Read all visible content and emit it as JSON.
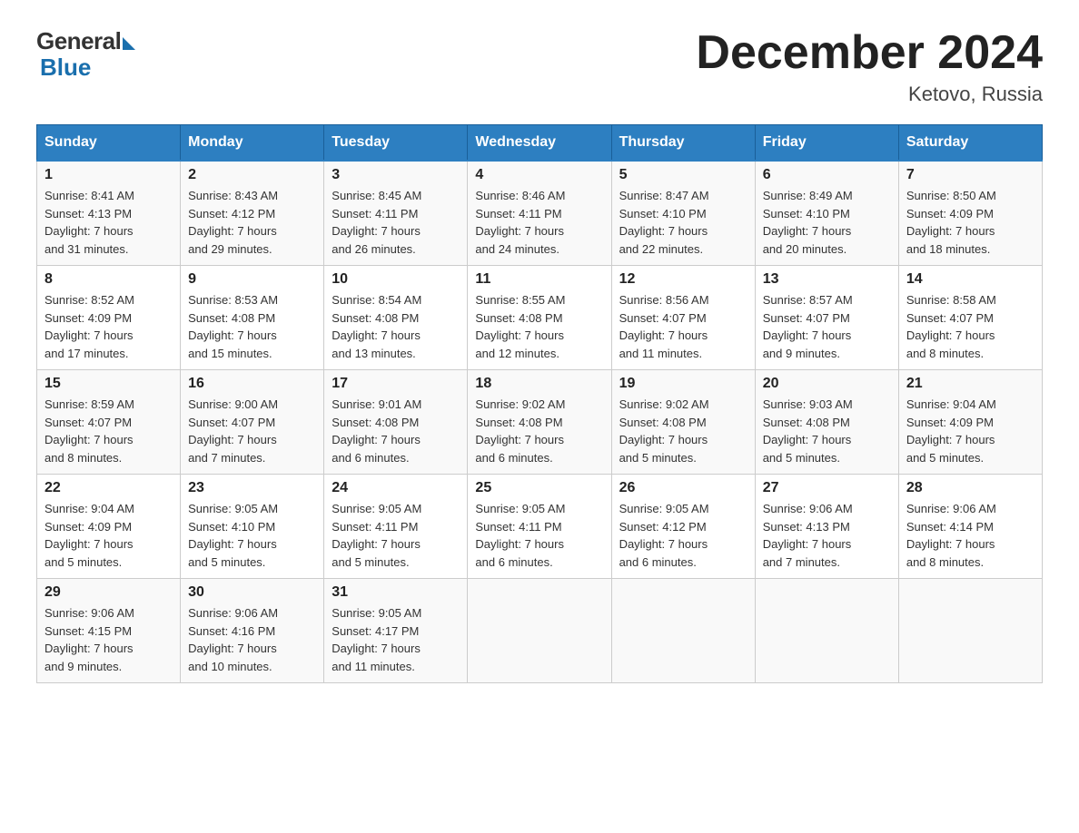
{
  "logo": {
    "general": "General",
    "blue": "Blue"
  },
  "title": "December 2024",
  "location": "Ketovo, Russia",
  "days_of_week": [
    "Sunday",
    "Monday",
    "Tuesday",
    "Wednesday",
    "Thursday",
    "Friday",
    "Saturday"
  ],
  "weeks": [
    [
      {
        "day": "1",
        "info": "Sunrise: 8:41 AM\nSunset: 4:13 PM\nDaylight: 7 hours\nand 31 minutes."
      },
      {
        "day": "2",
        "info": "Sunrise: 8:43 AM\nSunset: 4:12 PM\nDaylight: 7 hours\nand 29 minutes."
      },
      {
        "day": "3",
        "info": "Sunrise: 8:45 AM\nSunset: 4:11 PM\nDaylight: 7 hours\nand 26 minutes."
      },
      {
        "day": "4",
        "info": "Sunrise: 8:46 AM\nSunset: 4:11 PM\nDaylight: 7 hours\nand 24 minutes."
      },
      {
        "day": "5",
        "info": "Sunrise: 8:47 AM\nSunset: 4:10 PM\nDaylight: 7 hours\nand 22 minutes."
      },
      {
        "day": "6",
        "info": "Sunrise: 8:49 AM\nSunset: 4:10 PM\nDaylight: 7 hours\nand 20 minutes."
      },
      {
        "day": "7",
        "info": "Sunrise: 8:50 AM\nSunset: 4:09 PM\nDaylight: 7 hours\nand 18 minutes."
      }
    ],
    [
      {
        "day": "8",
        "info": "Sunrise: 8:52 AM\nSunset: 4:09 PM\nDaylight: 7 hours\nand 17 minutes."
      },
      {
        "day": "9",
        "info": "Sunrise: 8:53 AM\nSunset: 4:08 PM\nDaylight: 7 hours\nand 15 minutes."
      },
      {
        "day": "10",
        "info": "Sunrise: 8:54 AM\nSunset: 4:08 PM\nDaylight: 7 hours\nand 13 minutes."
      },
      {
        "day": "11",
        "info": "Sunrise: 8:55 AM\nSunset: 4:08 PM\nDaylight: 7 hours\nand 12 minutes."
      },
      {
        "day": "12",
        "info": "Sunrise: 8:56 AM\nSunset: 4:07 PM\nDaylight: 7 hours\nand 11 minutes."
      },
      {
        "day": "13",
        "info": "Sunrise: 8:57 AM\nSunset: 4:07 PM\nDaylight: 7 hours\nand 9 minutes."
      },
      {
        "day": "14",
        "info": "Sunrise: 8:58 AM\nSunset: 4:07 PM\nDaylight: 7 hours\nand 8 minutes."
      }
    ],
    [
      {
        "day": "15",
        "info": "Sunrise: 8:59 AM\nSunset: 4:07 PM\nDaylight: 7 hours\nand 8 minutes."
      },
      {
        "day": "16",
        "info": "Sunrise: 9:00 AM\nSunset: 4:07 PM\nDaylight: 7 hours\nand 7 minutes."
      },
      {
        "day": "17",
        "info": "Sunrise: 9:01 AM\nSunset: 4:08 PM\nDaylight: 7 hours\nand 6 minutes."
      },
      {
        "day": "18",
        "info": "Sunrise: 9:02 AM\nSunset: 4:08 PM\nDaylight: 7 hours\nand 6 minutes."
      },
      {
        "day": "19",
        "info": "Sunrise: 9:02 AM\nSunset: 4:08 PM\nDaylight: 7 hours\nand 5 minutes."
      },
      {
        "day": "20",
        "info": "Sunrise: 9:03 AM\nSunset: 4:08 PM\nDaylight: 7 hours\nand 5 minutes."
      },
      {
        "day": "21",
        "info": "Sunrise: 9:04 AM\nSunset: 4:09 PM\nDaylight: 7 hours\nand 5 minutes."
      }
    ],
    [
      {
        "day": "22",
        "info": "Sunrise: 9:04 AM\nSunset: 4:09 PM\nDaylight: 7 hours\nand 5 minutes."
      },
      {
        "day": "23",
        "info": "Sunrise: 9:05 AM\nSunset: 4:10 PM\nDaylight: 7 hours\nand 5 minutes."
      },
      {
        "day": "24",
        "info": "Sunrise: 9:05 AM\nSunset: 4:11 PM\nDaylight: 7 hours\nand 5 minutes."
      },
      {
        "day": "25",
        "info": "Sunrise: 9:05 AM\nSunset: 4:11 PM\nDaylight: 7 hours\nand 6 minutes."
      },
      {
        "day": "26",
        "info": "Sunrise: 9:05 AM\nSunset: 4:12 PM\nDaylight: 7 hours\nand 6 minutes."
      },
      {
        "day": "27",
        "info": "Sunrise: 9:06 AM\nSunset: 4:13 PM\nDaylight: 7 hours\nand 7 minutes."
      },
      {
        "day": "28",
        "info": "Sunrise: 9:06 AM\nSunset: 4:14 PM\nDaylight: 7 hours\nand 8 minutes."
      }
    ],
    [
      {
        "day": "29",
        "info": "Sunrise: 9:06 AM\nSunset: 4:15 PM\nDaylight: 7 hours\nand 9 minutes."
      },
      {
        "day": "30",
        "info": "Sunrise: 9:06 AM\nSunset: 4:16 PM\nDaylight: 7 hours\nand 10 minutes."
      },
      {
        "day": "31",
        "info": "Sunrise: 9:05 AM\nSunset: 4:17 PM\nDaylight: 7 hours\nand 11 minutes."
      },
      {
        "day": "",
        "info": ""
      },
      {
        "day": "",
        "info": ""
      },
      {
        "day": "",
        "info": ""
      },
      {
        "day": "",
        "info": ""
      }
    ]
  ]
}
